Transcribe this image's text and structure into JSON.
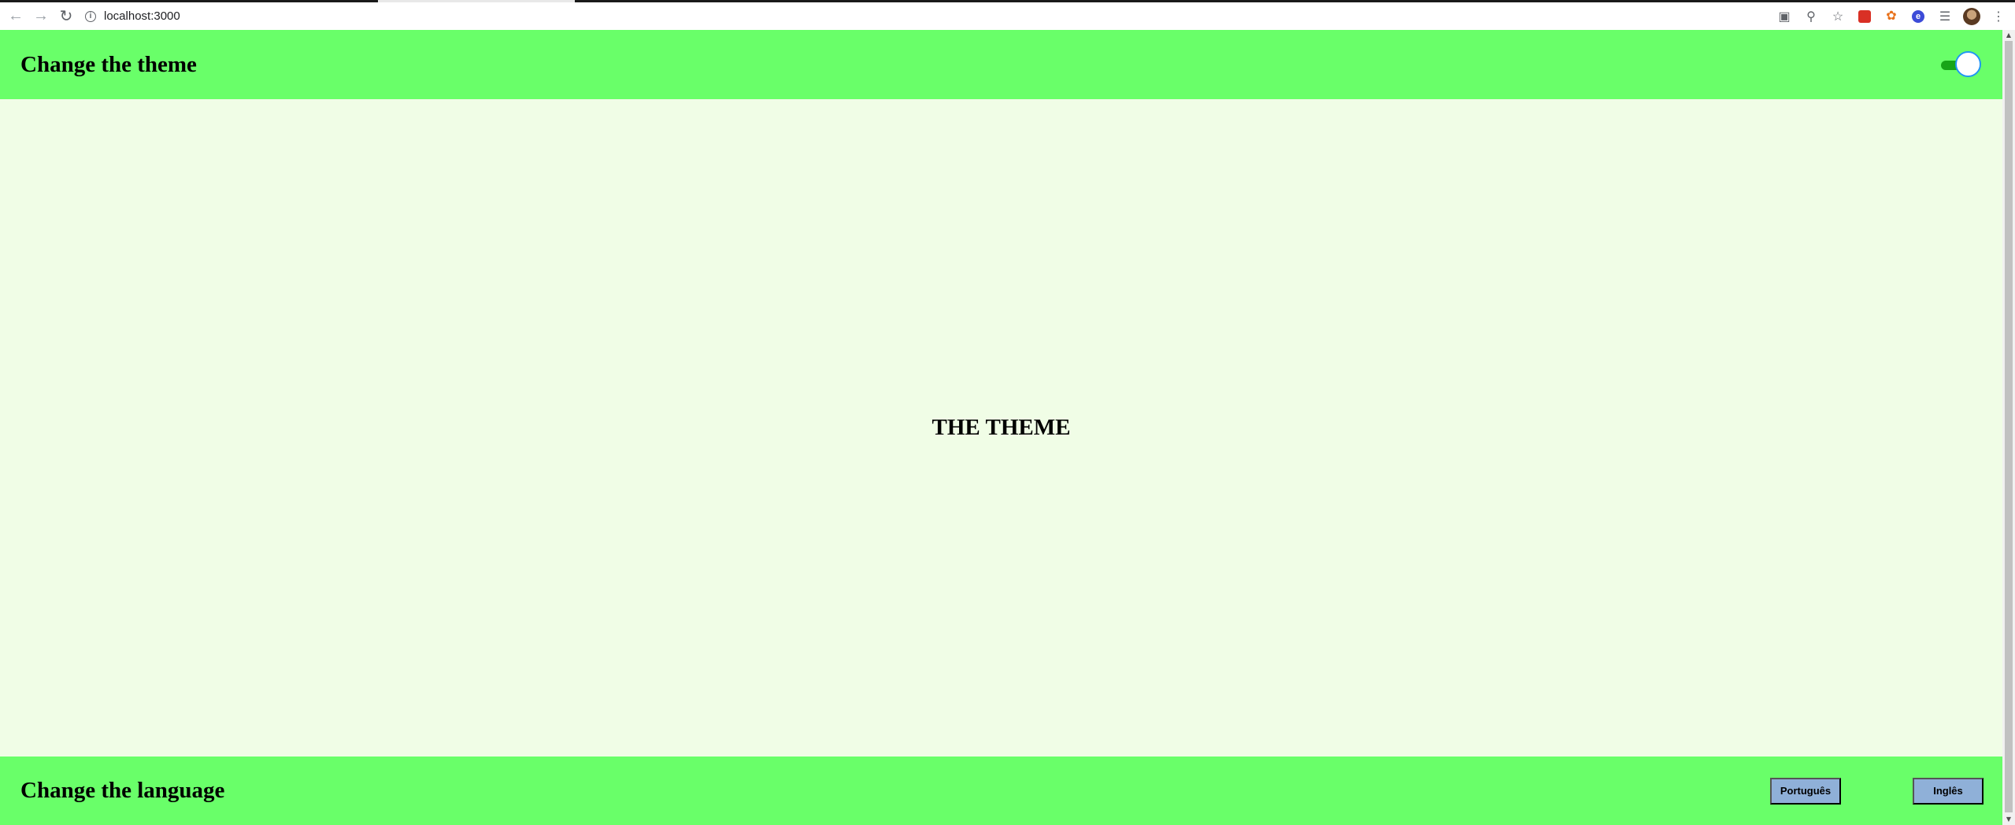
{
  "browser": {
    "url": "localhost:3000",
    "icons": [
      "back-arrow-icon",
      "forward-arrow-icon",
      "reload-icon",
      "info-icon",
      "translate-icon",
      "zoom-icon",
      "star-icon",
      "extension-red-icon",
      "extension-orange-icon",
      "extension-blue-icon",
      "media-icon",
      "avatar",
      "more-menu-icon"
    ]
  },
  "header": {
    "title": "Change the theme",
    "toggle_on": true,
    "color": "#69ff69"
  },
  "main": {
    "heading": "THE THEME",
    "background": "#f0fde6"
  },
  "footer": {
    "title": "Change the language",
    "buttons": {
      "portuguese": "Português",
      "english": "Inglês"
    }
  }
}
